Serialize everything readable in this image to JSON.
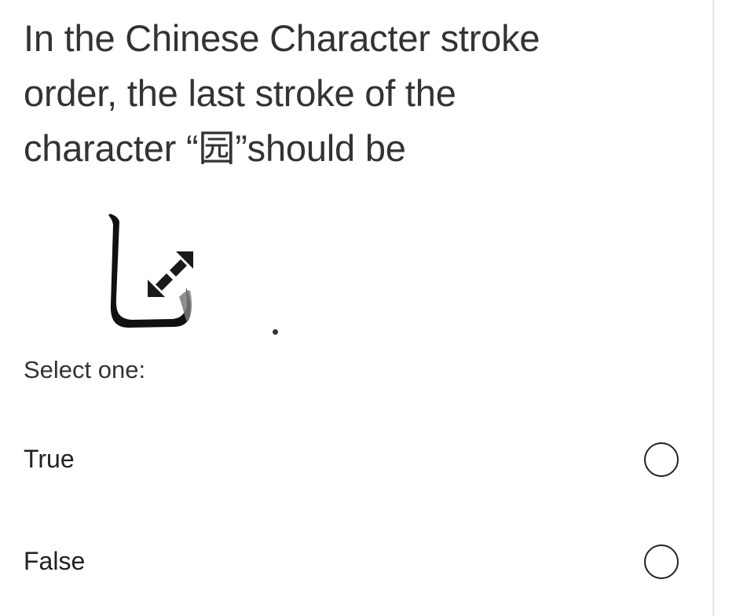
{
  "question": {
    "lines": [
      "In the Chinese Character stroke",
      "order, the last stroke of the",
      "character “园”should be"
    ]
  },
  "image": {
    "icon": "expand-arrows-icon"
  },
  "trailing_text": ".",
  "prompt": "Select one:",
  "options": [
    {
      "label": "True"
    },
    {
      "label": "False"
    }
  ],
  "colors": {
    "text": "#333333",
    "border": "#e6e6e6"
  }
}
